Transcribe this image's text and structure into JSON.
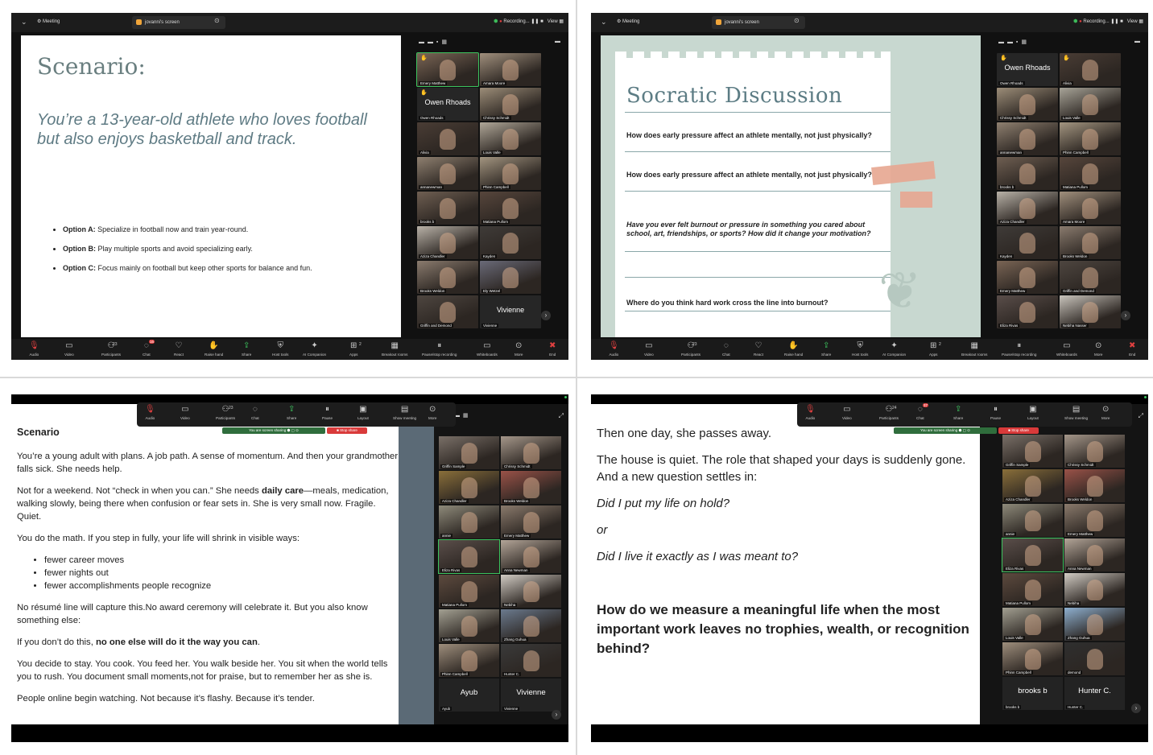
{
  "topbar": {
    "meeting_label": "Meeting",
    "share_label": "jovanni's screen",
    "recording_label": "Recording...",
    "view_label": "View"
  },
  "toolbar_items": [
    {
      "key": "audio",
      "label": "Audio",
      "icon": "mic-muted-icon"
    },
    {
      "key": "video",
      "label": "Video",
      "icon": "video-off-icon"
    },
    {
      "key": "participants",
      "label": "Participants",
      "icon": "participants-icon"
    },
    {
      "key": "chat",
      "label": "Chat",
      "icon": "chat-icon"
    },
    {
      "key": "react",
      "label": "React",
      "icon": "heart-icon"
    },
    {
      "key": "raise",
      "label": "Raise hand",
      "icon": "hand-icon"
    },
    {
      "key": "share",
      "label": "Share",
      "icon": "share-icon"
    },
    {
      "key": "hosttools",
      "label": "Host tools",
      "icon": "shield-icon"
    },
    {
      "key": "ai",
      "label": "AI Companion",
      "icon": "sparkle-icon"
    },
    {
      "key": "apps",
      "label": "Apps",
      "icon": "apps-icon"
    },
    {
      "key": "breakout",
      "label": "Breakout rooms",
      "icon": "breakout-icon"
    },
    {
      "key": "pause",
      "label": "Pause/stop recording",
      "icon": "pause-icon"
    },
    {
      "key": "whiteboards",
      "label": "Whiteboards",
      "icon": "whiteboard-icon"
    },
    {
      "key": "more",
      "label": "More",
      "icon": "more-icon"
    },
    {
      "key": "end",
      "label": "End",
      "icon": "end-icon"
    }
  ],
  "toolbar_counts": {
    "participants_q1": "23",
    "participants_q2": "23",
    "apps": "2",
    "chat_badge": "16"
  },
  "float_items": [
    {
      "label": "Audio"
    },
    {
      "label": "Video"
    },
    {
      "label": "Participants"
    },
    {
      "label": "Chat"
    },
    {
      "label": "Share"
    },
    {
      "label": "Pause"
    },
    {
      "label": "Layout"
    },
    {
      "label": "Show meeting"
    },
    {
      "label": "More"
    }
  ],
  "float_counts": {
    "q3_participants": "23",
    "q4_participants": "24",
    "q4_chat": "37"
  },
  "sharing": {
    "you_are_sharing": "You are screen sharing",
    "stop_share": "Stop share"
  },
  "q1": {
    "title": "Scenario:",
    "lead": "You’re a 13-year-old athlete who loves football but also enjoys basketball and track.",
    "options": [
      {
        "label": "Option A:",
        "text": " Specialize in football now and train year-round."
      },
      {
        "label": "Option B:",
        "text": " Play multiple sports and avoid specializing early."
      },
      {
        "label": "Option C:",
        "text": " Focus mainly on football but keep other sports for balance and fun."
      }
    ],
    "tiles": [
      {
        "name": "Emery Matthew",
        "active": true,
        "hand": true,
        "color": "#7a6555"
      },
      {
        "name": "Amara Moore",
        "color": "#a08f7c"
      },
      {
        "name": "Owen Rhoads",
        "dark": true,
        "big": "Owen Rhoads",
        "hand": true
      },
      {
        "name": "Chrissy Schmidt",
        "color": "#9c8d78"
      },
      {
        "name": "Alivia",
        "color": "#4a3d35"
      },
      {
        "name": "Louis Valle",
        "color": "#b0a798"
      },
      {
        "name": "annanewman",
        "color": "#8f8070"
      },
      {
        "name": "Phinn Campbell",
        "color": "#a39580"
      },
      {
        "name": "brooks b",
        "color": "#6f5f52"
      },
      {
        "name": "Matiana Pullom",
        "color": "#57463c"
      },
      {
        "name": "Aziza Chandler",
        "color": "#b9b2a8"
      },
      {
        "name": "Kayden",
        "color": "#3f3b38"
      },
      {
        "name": "Brooks Weldon",
        "color": "#8a7b6e"
      },
      {
        "name": "Ely Wetzel",
        "color": "#6a6a78"
      },
      {
        "name": "Griffin and Demond",
        "color": "#4e4640"
      },
      {
        "name": "Vivienne",
        "dark": true,
        "big": "Vivienne"
      }
    ]
  },
  "q2": {
    "title": "Socratic Discussion",
    "questions": [
      "How does early pressure affect an athlete mentally, not just physically?",
      "How does early pressure affect an athlete mentally, not just physically?",
      "Have you ever felt burnout or pressure in something you cared about school, art, friendships, or sports? How did it change your motivation?",
      "Where do you think hard work cross the line into burnout?"
    ],
    "tiles": [
      {
        "name": "Owen Rhoads",
        "dark": true,
        "big": "Owen Rhoads",
        "hand": true
      },
      {
        "name": "Alivia",
        "color": "#4a3d35",
        "hand": true
      },
      {
        "name": "Chrissy Schmidt",
        "color": "#9c8d78"
      },
      {
        "name": "Louis Valle",
        "color": "#a8a498"
      },
      {
        "name": "annanewman",
        "color": "#8f8070"
      },
      {
        "name": "Phinn Campbell",
        "color": "#a39580"
      },
      {
        "name": "brooks b",
        "color": "#6f5f52"
      },
      {
        "name": "Matiana Pullom",
        "color": "#57463c"
      },
      {
        "name": "Aziza Chandler",
        "color": "#b9b2a8"
      },
      {
        "name": "Amara Moore",
        "color": "#a08f7c"
      },
      {
        "name": "Kayden",
        "color": "#3f3b38"
      },
      {
        "name": "Brooks Weldon",
        "color": "#8a7b6e"
      },
      {
        "name": "Emery Matthew",
        "color": "#7a6555"
      },
      {
        "name": "Griffin and Demond",
        "color": "#4e4640"
      },
      {
        "name": "Eliza Rivas",
        "color": "#5a4e4a"
      },
      {
        "name": "Nebiha Nasser",
        "color": "#c9c4bc"
      }
    ]
  },
  "q3": {
    "heading": "Scenario",
    "p1": "You’re a young adult with plans. A job path. A sense of momentum. And then your grandmother falls sick.  She needs help.",
    "p2a": "Not for a weekend. Not “check in when you can.” She needs ",
    "p2b": "daily care",
    "p2c": "—meals, medication, walking slowly, being there when confusion or fear sets in. She is very small now. Fragile. Quiet.",
    "p3": "You do the math. If you step in fully, your life will shrink in visible ways:",
    "bullets": [
      "fewer career moves",
      "fewer nights out",
      "fewer accomplishments people recognize"
    ],
    "p4": "No résumé line will capture this.No award ceremony will celebrate it. But you also know something else:",
    "p5a": "If you don’t do this, ",
    "p5b": "no one else will do it the way you can",
    "p5c": ".",
    "p6": "You decide to stay. You cook. You feed her. You walk beside her. You sit when the world tells you to rush. You document small moments,not for praise, but to remember her as she is.",
    "p7": "People online begin watching. Not because it’s flashy. Because it’s tender.",
    "tiles": [
      {
        "name": "Griffin Sample",
        "color": "#7a7068"
      },
      {
        "name": "Chrissy Schmidt",
        "color": "#a5978a"
      },
      {
        "name": "Aziza Chandler",
        "color": "#8a6f3a"
      },
      {
        "name": "Brooks Weldon",
        "color": "#9a5248"
      },
      {
        "name": "annie",
        "color": "#8e8a7a"
      },
      {
        "name": "Emery Matthew",
        "color": "#8a7a6c"
      },
      {
        "name": "Eliza Rivas",
        "color": "#5a4e4a",
        "active": true
      },
      {
        "name": "Anna Newman",
        "color": "#b3a598"
      },
      {
        "name": "Matiana Pullom",
        "color": "#5d4a3e"
      },
      {
        "name": "Nebiha",
        "color": "#d2ccc4"
      },
      {
        "name": "Louis Valle",
        "color": "#a3a092"
      },
      {
        "name": "Zhang Guhua",
        "color": "#6b7a8e"
      },
      {
        "name": "Phinn Campbell",
        "color": "#9e8e7c"
      },
      {
        "name": "Hunter C.",
        "color": "#3a3a3a"
      },
      {
        "name": "Ayub",
        "dark": true,
        "big": "Ayub"
      },
      {
        "name": "Vivienne",
        "dark": true,
        "big": "Vivienne"
      }
    ]
  },
  "q4": {
    "l1": "Then one day, she passes away.",
    "l2": "The house is quiet. The role that shaped your days is suddenly gone. And a new question settles in:",
    "l3": "Did I put my life on hold?",
    "l4": "or",
    "l5": "Did I live it exactly as I was meant to?",
    "l6": "How do we measure a meaningful life when the most important work leaves no trophies, wealth, or recognition behind?",
    "tiles": [
      {
        "name": "Griffin Sample",
        "color": "#7a7068"
      },
      {
        "name": "Chrissy Schmidt",
        "color": "#a5978a"
      },
      {
        "name": "Aziza Chandler",
        "color": "#8a6f3a"
      },
      {
        "name": "Brooks Weldon",
        "color": "#9a5248"
      },
      {
        "name": "annie",
        "color": "#8e8a7a"
      },
      {
        "name": "Emery Matthew",
        "color": "#8a7a6c"
      },
      {
        "name": "Eliza Rivas",
        "color": "#5a4e4a",
        "active": true
      },
      {
        "name": "Anna Newman",
        "color": "#b3a598"
      },
      {
        "name": "Matiana Pullom",
        "color": "#5d4a3e"
      },
      {
        "name": "Nebiha",
        "color": "#d2ccc4"
      },
      {
        "name": "Louis Valle",
        "color": "#a3a092"
      },
      {
        "name": "Zhang Guhua",
        "color": "#8eb0d0"
      },
      {
        "name": "Phinn Campbell",
        "color": "#9e8e7c"
      },
      {
        "name": "demond",
        "color": "#2f2f2f"
      },
      {
        "name": "brooks b",
        "dark": true,
        "big": "brooks b"
      },
      {
        "name": "Hunter C.",
        "dark": true,
        "big": "Hunter C."
      }
    ]
  }
}
